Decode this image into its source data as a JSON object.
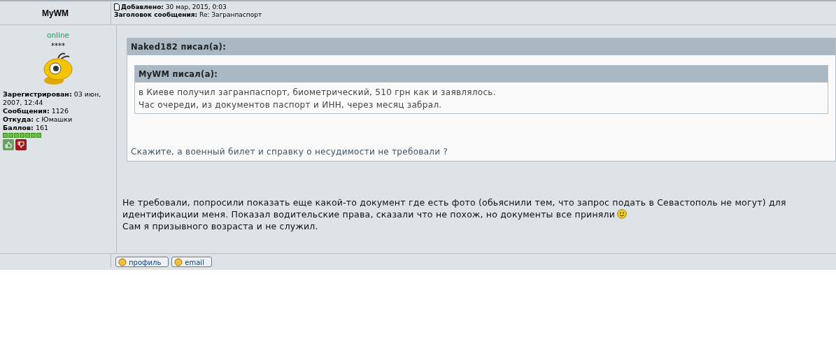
{
  "author": {
    "name": "MyWM",
    "status": "online",
    "rank": "****",
    "info": [
      "**Зарегистрирован:** 03 июн, 2007, 12:44",
      "**Сообщения:** 1126",
      "**Откуда:** с Юмашки",
      "**Баллов:** 161"
    ],
    "stars": 7
  },
  "post_header": {
    "added": "**Добавлено:** 30 мар, 2015, 0:03",
    "subject": "**Заголовок сообщения:** Re: Загранпаспорт"
  },
  "quote": {
    "title": "Naked182 писал(а):",
    "inner_quote": {
      "title": "MyWM писал(а):",
      "lines": [
        "в Киеве получил загранпаспорт, биометрический, 510 грн как и заявлялось.",
        "Час очереди, из документов паспорт и ИНН, через месяц забрал."
      ]
    },
    "text": "Скажите, а военный билет и справку о несудимости не требовали ?"
  },
  "reply": {
    "lines": [
      "Не требовали, попросили показать еще какой-то документ где есть фото (обьяснили тем, что запрос подать в Севастополь не могут) для",
      "идентификации меня. Показал водительские права, сказали что не похож, но документы все приняли",
      "Сам я призывного возраста и не служил."
    ]
  },
  "buttons": [
    "профиль",
    "email"
  ]
}
